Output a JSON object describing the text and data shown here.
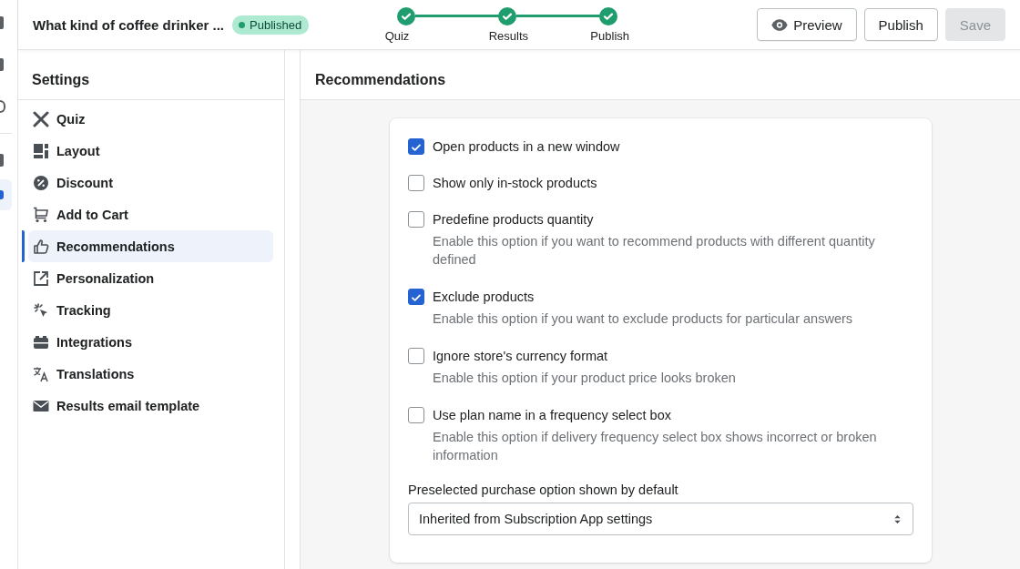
{
  "header": {
    "title": "What kind of coffee drinker ...",
    "status": "Published"
  },
  "steps": [
    {
      "label": "Quiz",
      "done": true
    },
    {
      "label": "Results",
      "done": true
    },
    {
      "label": "Publish",
      "done": true
    }
  ],
  "actions": [
    {
      "label": "Preview",
      "kind": "preview",
      "disabled": false
    },
    {
      "label": "Publish",
      "kind": "plain",
      "disabled": false
    },
    {
      "label": "Save",
      "kind": "plain",
      "disabled": true
    }
  ],
  "sidebar": {
    "title": "Settings",
    "items": [
      {
        "label": "Quiz",
        "selected": false
      },
      {
        "label": "Layout",
        "selected": false
      },
      {
        "label": "Discount",
        "selected": false
      },
      {
        "label": "Add to Cart",
        "selected": false
      },
      {
        "label": "Recommendations",
        "selected": true
      },
      {
        "label": "Personalization",
        "selected": false
      },
      {
        "label": "Tracking",
        "selected": false
      },
      {
        "label": "Integrations",
        "selected": false
      },
      {
        "label": "Translations",
        "selected": false
      },
      {
        "label": "Results email template",
        "selected": false
      }
    ]
  },
  "panel": {
    "title": "Recommendations",
    "options": [
      {
        "label": "Open products in a new window",
        "checked": true
      },
      {
        "label": "Show only in-stock products",
        "checked": false
      },
      {
        "label": "Predefine products quantity",
        "checked": false,
        "help": "Enable this option if you want to recommend products with different quantity defined"
      },
      {
        "label": "Exclude products",
        "checked": true,
        "help": "Enable this option if you want to exclude products for particular answers"
      },
      {
        "label": "Ignore store's currency format",
        "checked": false,
        "help": "Enable this option if your product price looks broken"
      },
      {
        "label": "Use plan name in a frequency select box",
        "checked": false,
        "help": "Enable this option if delivery frequency select box shows incorrect or broken information"
      }
    ],
    "select": {
      "label": "Preselected purchase option shown by default",
      "value": "Inherited from Subscription App settings"
    }
  }
}
